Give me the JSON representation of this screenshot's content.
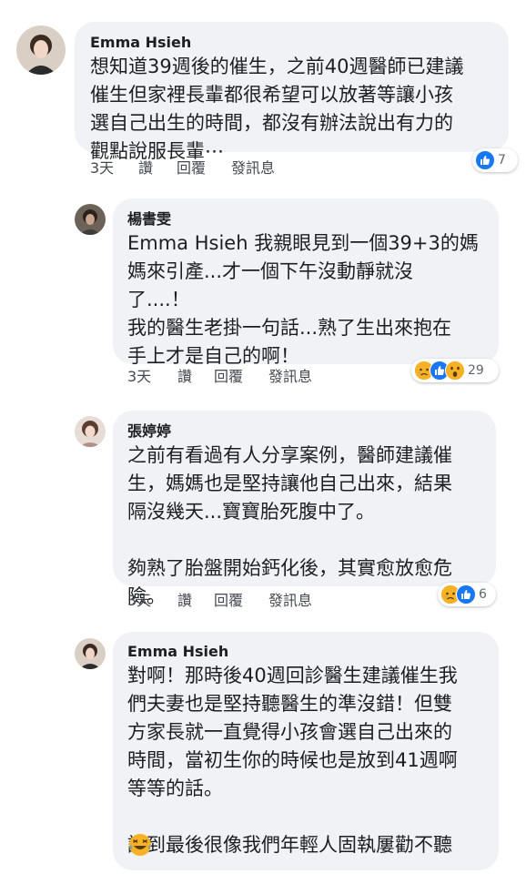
{
  "comments": [
    {
      "author": "Emma Hsieh",
      "text": "想知道39週後的催生，之前40週醫師已建議\n催生但家裡長輩都很希望可以放著等讓小孩\n選自己出生的時間，都沒有辦法說出有力的\n觀點說服長輩⋯",
      "time": "3天",
      "read": "讚",
      "reply": "回覆",
      "message": "發訊息",
      "reactions": [
        "like"
      ],
      "reaction_count": "7"
    },
    {
      "author": "楊書雯",
      "text": "Emma Hsieh 我親眼見到一個39+3的媽\n媽來引產...才一個下午沒動靜就沒\n了....！\n我的醫生老掛一句話...熟了生出來抱在\n手上才是自己的啊！",
      "time": "3天",
      "read": "讚",
      "reply": "回覆",
      "message": "發訊息",
      "reactions": [
        "sad",
        "like",
        "wow"
      ],
      "reaction_count": "29"
    },
    {
      "author": "張婷婷",
      "text": "之前有看過有人分享案例，醫師建議催\n生，媽媽也是堅持讓他自己出來，結果\n隔沒幾天...寶寶胎死腹中了。\n\n夠熟了胎盤開始鈣化後，其實愈放愈危\n險。",
      "time": "3天",
      "read": "讚",
      "reply": "回覆",
      "message": "發訊息",
      "reactions": [
        "sad",
        "like"
      ],
      "reaction_count": "6"
    },
    {
      "author": "Emma Hsieh",
      "text": "對啊！那時後40週回診醫生建議催生我\n們夫妻也是堅持聽醫生的準沒錯！但雙\n方家長就一直覺得小孩會選自己出來的\n時間，當初生你的時候也是放到41週啊\n等等的話。\n\n講到最後很像我們年輕人固執屢勸不聽",
      "emoji": "laughing-emoji"
    }
  ],
  "colors": {
    "bubble": "#f0f2f5",
    "like": "#1877f2",
    "emoji_yellow": "#f7b125"
  }
}
